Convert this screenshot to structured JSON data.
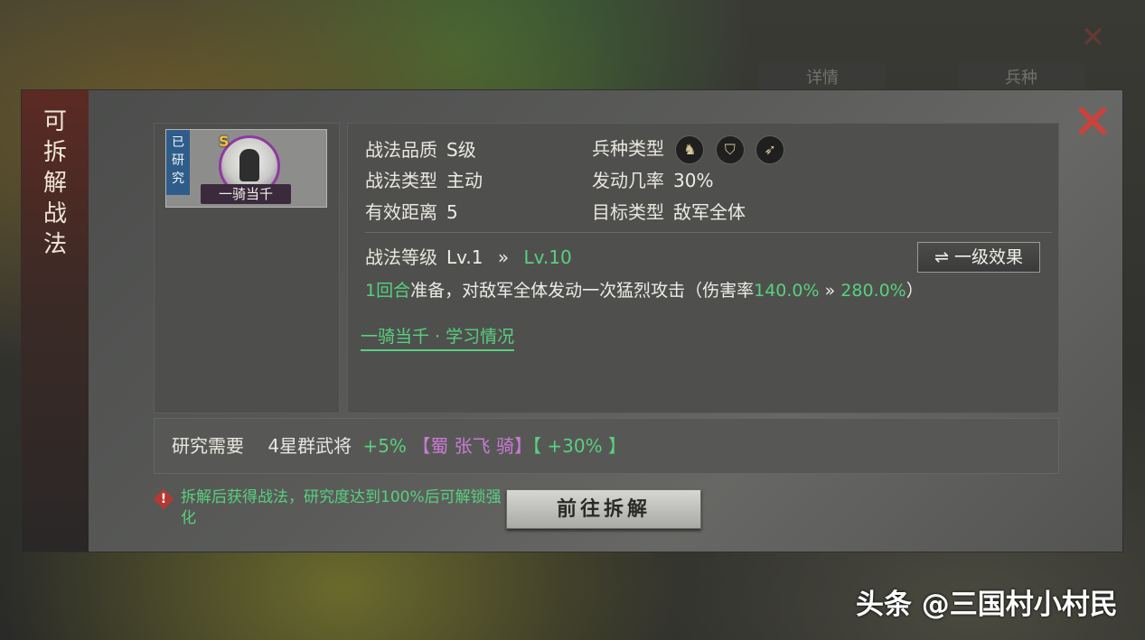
{
  "background": {
    "tabs": [
      "详情",
      "兵种"
    ]
  },
  "dialog": {
    "side_title": [
      "可",
      "拆",
      "解",
      "战",
      "法"
    ],
    "card": {
      "ribbon": [
        "已",
        "研",
        "究"
      ],
      "grade": "S",
      "name": "一骑当千"
    },
    "info": {
      "quality_label": "战法品质",
      "quality_value": "S级",
      "type_label": "战法类型",
      "type_value": "主动",
      "range_label": "有效距离",
      "range_value": "5",
      "troop_label": "兵种类型",
      "troop_icons": [
        "cavalry-icon",
        "shield-icon",
        "bow-icon"
      ],
      "rate_label": "发动几率",
      "rate_value": "30%",
      "target_label": "目标类型",
      "target_value": "敌军全体"
    },
    "level": {
      "label": "战法等级",
      "from": "Lv.1",
      "arrow": "»",
      "to": "Lv.10",
      "effect_button": "一级效果",
      "swap_icon": "⇌"
    },
    "description": {
      "rounds": "1回合",
      "text1": "准备，对敌军全体发动一次猛烈攻击（伤害率",
      "from": "140.0%",
      "arrow": " » ",
      "to": "280.0%",
      "close": "）"
    },
    "study_link": "一骑当千 · 学习情况",
    "requirement": {
      "label": "研究需要",
      "item": "4星群武将",
      "bonus": "+5%",
      "bracket_open": "【",
      "unit": "蜀 张飞 骑",
      "bracket_close": "】",
      "bonus2": "【 +30% 】"
    },
    "warning": "拆解后获得战法，研究度达到100%后可解锁强化",
    "go_button": "前往拆解"
  },
  "watermark": "头条 @三国村小村民",
  "colors": {
    "accent_green": "#58d07e",
    "close_red": "#c9433c",
    "purple": "#c87ad3"
  }
}
